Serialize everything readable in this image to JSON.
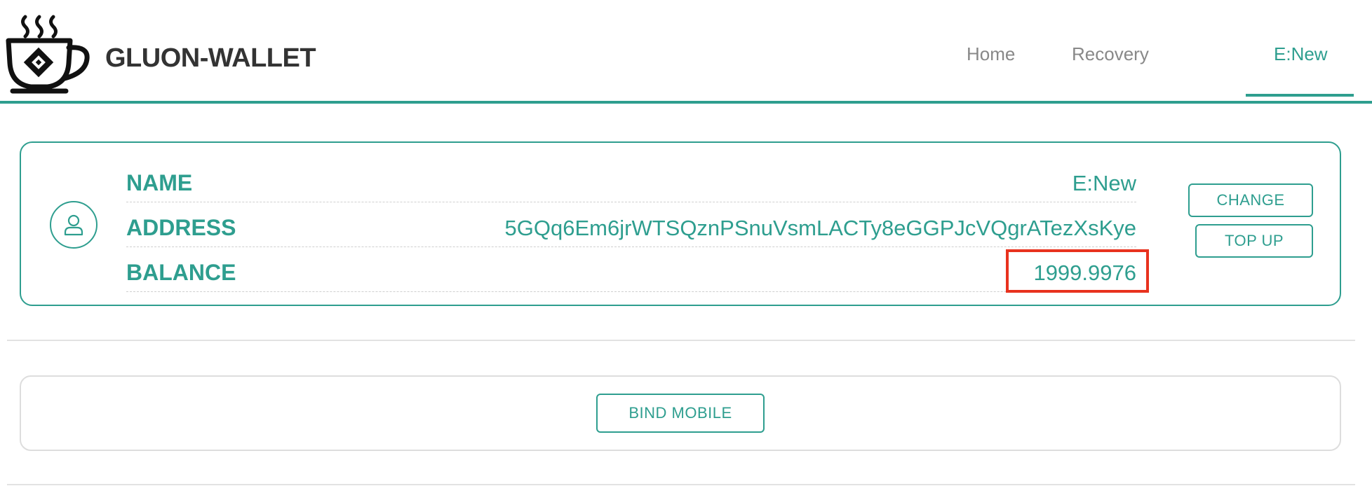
{
  "app": {
    "title": "GLUON-WALLET",
    "logo_icon": "steaming-cup-chip-logo",
    "accent_color": "#2e9e8f",
    "highlight_color": "#e8321e"
  },
  "nav": {
    "items": [
      {
        "label": "Home",
        "active": false
      },
      {
        "label": "Recovery",
        "active": false
      },
      {
        "label": "E:New",
        "active": true
      }
    ]
  },
  "account": {
    "avatar_icon": "user-icon",
    "rows": [
      {
        "label": "NAME",
        "value": "E:New"
      },
      {
        "label": "ADDRESS",
        "value": "5GQq6Em6jrWTSQznPSnuVsmLACTy8eGGPJcVQgrATezXsKye"
      },
      {
        "label": "BALANCE",
        "value": "1999.9976",
        "highlighted": true
      }
    ],
    "actions": {
      "change_label": "CHANGE",
      "topup_label": "TOP UP"
    }
  },
  "bind": {
    "button_label": "BIND MOBILE"
  }
}
